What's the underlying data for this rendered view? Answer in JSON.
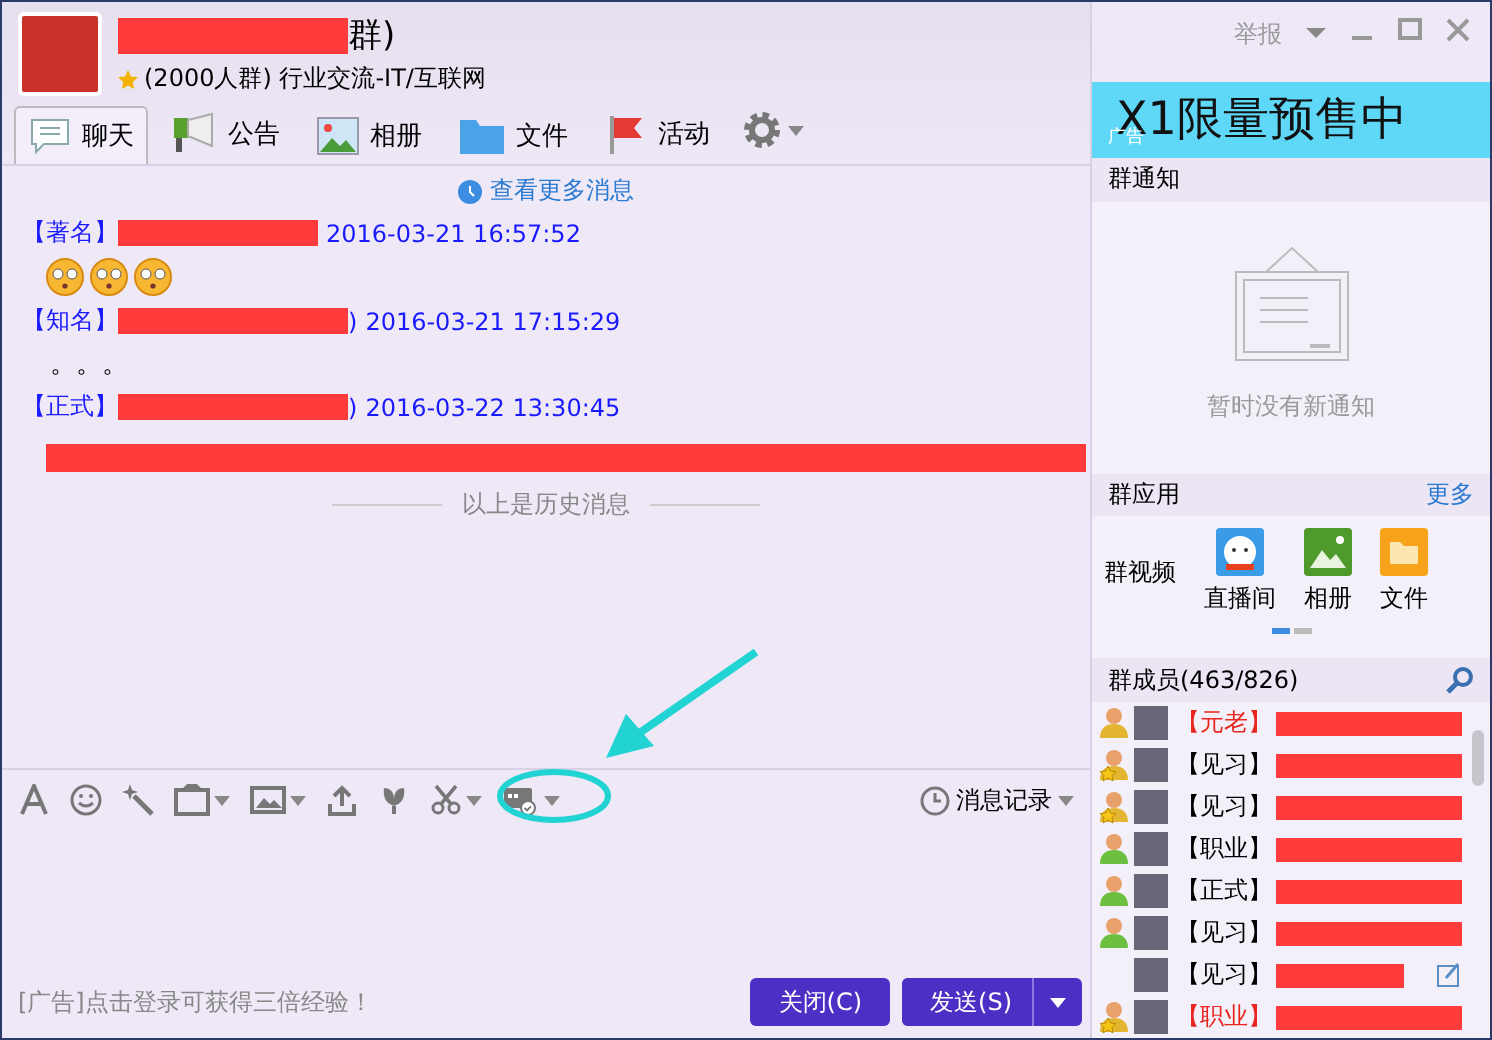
{
  "window": {
    "title_tail": "群)",
    "group_info": "(2000人群) 行业交流-IT/互联网",
    "report": "举报"
  },
  "tabs": [
    {
      "label": "聊天",
      "kind": "chat",
      "selected": true
    },
    {
      "label": "公告",
      "kind": "notice",
      "selected": false
    },
    {
      "label": "相册",
      "kind": "album",
      "selected": false
    },
    {
      "label": "文件",
      "kind": "file",
      "selected": false
    },
    {
      "label": "活动",
      "kind": "activity",
      "selected": false
    }
  ],
  "ad_banner": {
    "badge": "广告",
    "text": "X1限量预售中"
  },
  "chat": {
    "more_link": "查看更多消息",
    "messages": [
      {
        "role": "【著名】",
        "time": "2016-03-21 16:57:52",
        "kind": "emoji-row"
      },
      {
        "role": "【知名】",
        "name_tail": ")",
        "time": "2016-03-21 17:15:29",
        "kind": "text",
        "text": "。。。"
      },
      {
        "role": "【正式】",
        "name_tail": ")",
        "time": "2016-03-22 13:30:45",
        "kind": "redacted"
      }
    ],
    "history_divider": "以上是历史消息"
  },
  "toolbar": {
    "history": "消息记录"
  },
  "footer": {
    "ad_text": "[广告]点击登录可获得三倍经验！",
    "buttons": [
      "关闭(C)",
      "发送(S)"
    ]
  },
  "notice": {
    "title": "群通知",
    "empty_text": "暂时没有新通知"
  },
  "apps": {
    "title": "群应用",
    "more": "更多",
    "video": "群视频",
    "items": [
      {
        "label": "直播间",
        "kind": "live"
      },
      {
        "label": "相册",
        "kind": "album"
      },
      {
        "label": "文件",
        "kind": "file"
      }
    ],
    "pages": [
      {
        "selected": true
      },
      {
        "selected": false
      }
    ]
  },
  "members": {
    "title": "群成员(463/826)",
    "items": [
      {
        "role": "【元老】",
        "color": "#e8261f",
        "kind": "owner",
        "edit": false
      },
      {
        "role": "【见习】",
        "color": "#000000",
        "kind": "star",
        "edit": false
      },
      {
        "role": "【见习】",
        "color": "#000000",
        "kind": "star",
        "edit": false
      },
      {
        "role": "【职业】",
        "color": "#000000",
        "kind": "member",
        "edit": false
      },
      {
        "role": "【正式】",
        "color": "#000000",
        "kind": "member",
        "edit": false
      },
      {
        "role": "【见习】",
        "color": "#000000",
        "kind": "member",
        "edit": false
      },
      {
        "role": "【见习】",
        "color": "#000000",
        "kind": "none",
        "edit": true
      },
      {
        "role": "【职业】",
        "color": "#e8261f",
        "kind": "star",
        "edit": false
      }
    ]
  }
}
